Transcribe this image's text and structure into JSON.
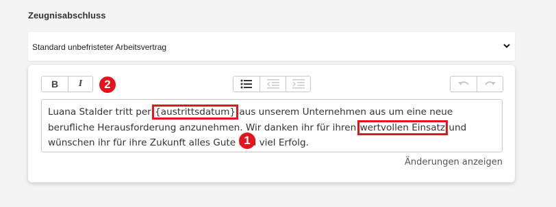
{
  "section": {
    "label": "Zeugnisabschluss"
  },
  "template_select": {
    "value": "Standard unbefristeter Arbeitsvertrag",
    "icon": "chevron-down-icon"
  },
  "toolbar": {
    "bold_label": "B",
    "italic_label": "I",
    "list_icons": [
      "bulleted-list-icon",
      "outdent-icon",
      "indent-icon"
    ],
    "history_icons": [
      "undo-icon",
      "redo-icon"
    ]
  },
  "editor": {
    "text_before_placeholder": "Luana Stalder tritt per ",
    "placeholder": "{austrittsdatum}",
    "text_middle_1": " aus unserem Unternehmen aus um eine neue berufliche Herausforderung anzunehmen. Wir danken ihr für ihren ",
    "highlight_phrase": "wertvollen Einsatz",
    "text_after": " und wünschen ihr für ihre Zukunft alles Gute und viel Erfolg."
  },
  "badges": {
    "one": "1",
    "two": "2"
  },
  "changes_link": "Änderungen anzeigen",
  "colors": {
    "annotation_red": "#e3141c",
    "background": "#f4f4f4"
  }
}
